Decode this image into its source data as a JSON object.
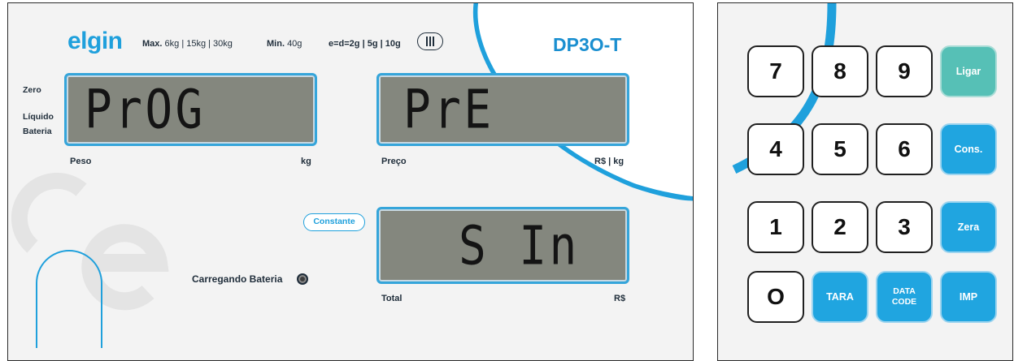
{
  "brand": {
    "logo_text": "elgin",
    "model": "DP3O-T"
  },
  "specs": {
    "max_label": "Max.",
    "max_value": "6kg | 15kg | 30kg",
    "min_label": "Min.",
    "min_value": "40g",
    "division": "e=d=2g | 5g | 10g"
  },
  "indicators": {
    "zero": "Zero",
    "net": "Líquido",
    "battery": "Bateria"
  },
  "displays": {
    "weight": {
      "value": "PrOG",
      "label": "Peso",
      "unit": "kg"
    },
    "price": {
      "value": "PrE",
      "label": "Preço",
      "unit": "R$ | kg"
    },
    "total": {
      "value": "S In",
      "label": "Total",
      "unit": "R$"
    }
  },
  "constant_badge": "Constante",
  "charging_label": "Carregando Bateria",
  "keypad": {
    "keys": [
      {
        "label": "7",
        "kind": "num"
      },
      {
        "label": "8",
        "kind": "num"
      },
      {
        "label": "9",
        "kind": "num"
      },
      {
        "label": "Ligar",
        "kind": "on"
      },
      {
        "label": "4",
        "kind": "num"
      },
      {
        "label": "5",
        "kind": "num"
      },
      {
        "label": "6",
        "kind": "num"
      },
      {
        "label": "Cons.",
        "kind": "fn"
      },
      {
        "label": "1",
        "kind": "num"
      },
      {
        "label": "2",
        "kind": "num"
      },
      {
        "label": "3",
        "kind": "num"
      },
      {
        "label": "Zera",
        "kind": "fn"
      },
      {
        "label": "O",
        "kind": "num"
      },
      {
        "label": "TARA",
        "kind": "fn"
      },
      {
        "label": "DATA",
        "label2": "CODE",
        "kind": "fn"
      },
      {
        "label": "IMP",
        "kind": "fn"
      }
    ]
  },
  "colors": {
    "accent": "#1fa0dc",
    "lcd": "#84877e",
    "power_key": "#56c0b6"
  }
}
